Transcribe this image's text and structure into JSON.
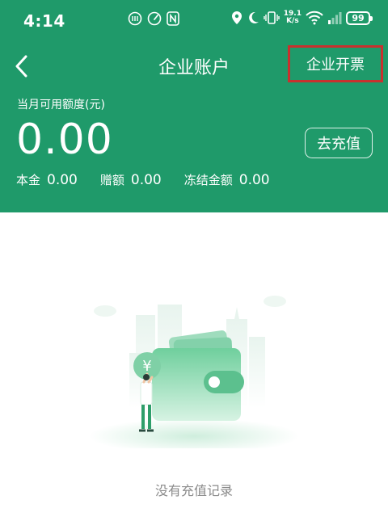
{
  "status_bar": {
    "time": "4:14",
    "net_speed_value": "19.1",
    "net_speed_unit": "K/s",
    "battery": "99"
  },
  "nav": {
    "title": "企业账户",
    "invoice_label": "企业开票"
  },
  "account": {
    "limit_label": "当月可用额度(元)",
    "limit_amount": "0.00",
    "recharge_label": "去充值",
    "principal_label": "本金",
    "principal_value": "0.00",
    "bonus_label": "赠额",
    "bonus_value": "0.00",
    "frozen_label": "冻结金额",
    "frozen_value": "0.00"
  },
  "empty_state": {
    "currency_symbol": "¥",
    "message": "没有充值记录"
  },
  "colors": {
    "header_green": "#1f9a6a",
    "highlight_red": "#c8312e",
    "muted_text": "#8a8a8a"
  }
}
